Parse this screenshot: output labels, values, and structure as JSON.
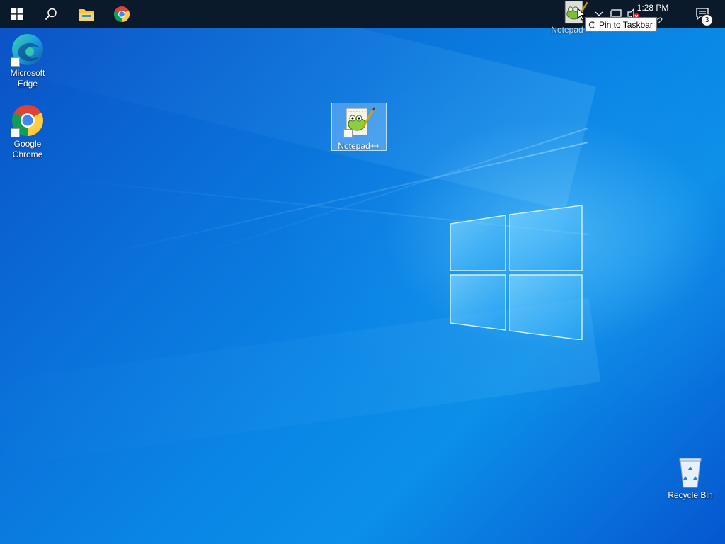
{
  "taskbar": {
    "start_icon": "windows-start-icon",
    "search_icon": "search-icon",
    "file_explorer_icon": "folder-icon",
    "chrome_icon": "chrome-icon",
    "tray": {
      "time": "1:28 PM",
      "date": "/3/2022",
      "notification_count": "3"
    }
  },
  "drag": {
    "ghost_label": "Notepad++",
    "tooltip": "Pin to Taskbar"
  },
  "desktop_icons": {
    "edge": {
      "label_line1": "Microsoft",
      "label_line2": "Edge"
    },
    "chrome": {
      "label_line1": "Google",
      "label_line2": "Chrome"
    },
    "notepad": {
      "label": "Notepad++"
    },
    "recycle": {
      "label": "Recycle Bin"
    }
  },
  "colors": {
    "taskbar": "#0b1a2b",
    "wallpaper_base": "#0a86e6",
    "selection": "#8cc8ff"
  }
}
